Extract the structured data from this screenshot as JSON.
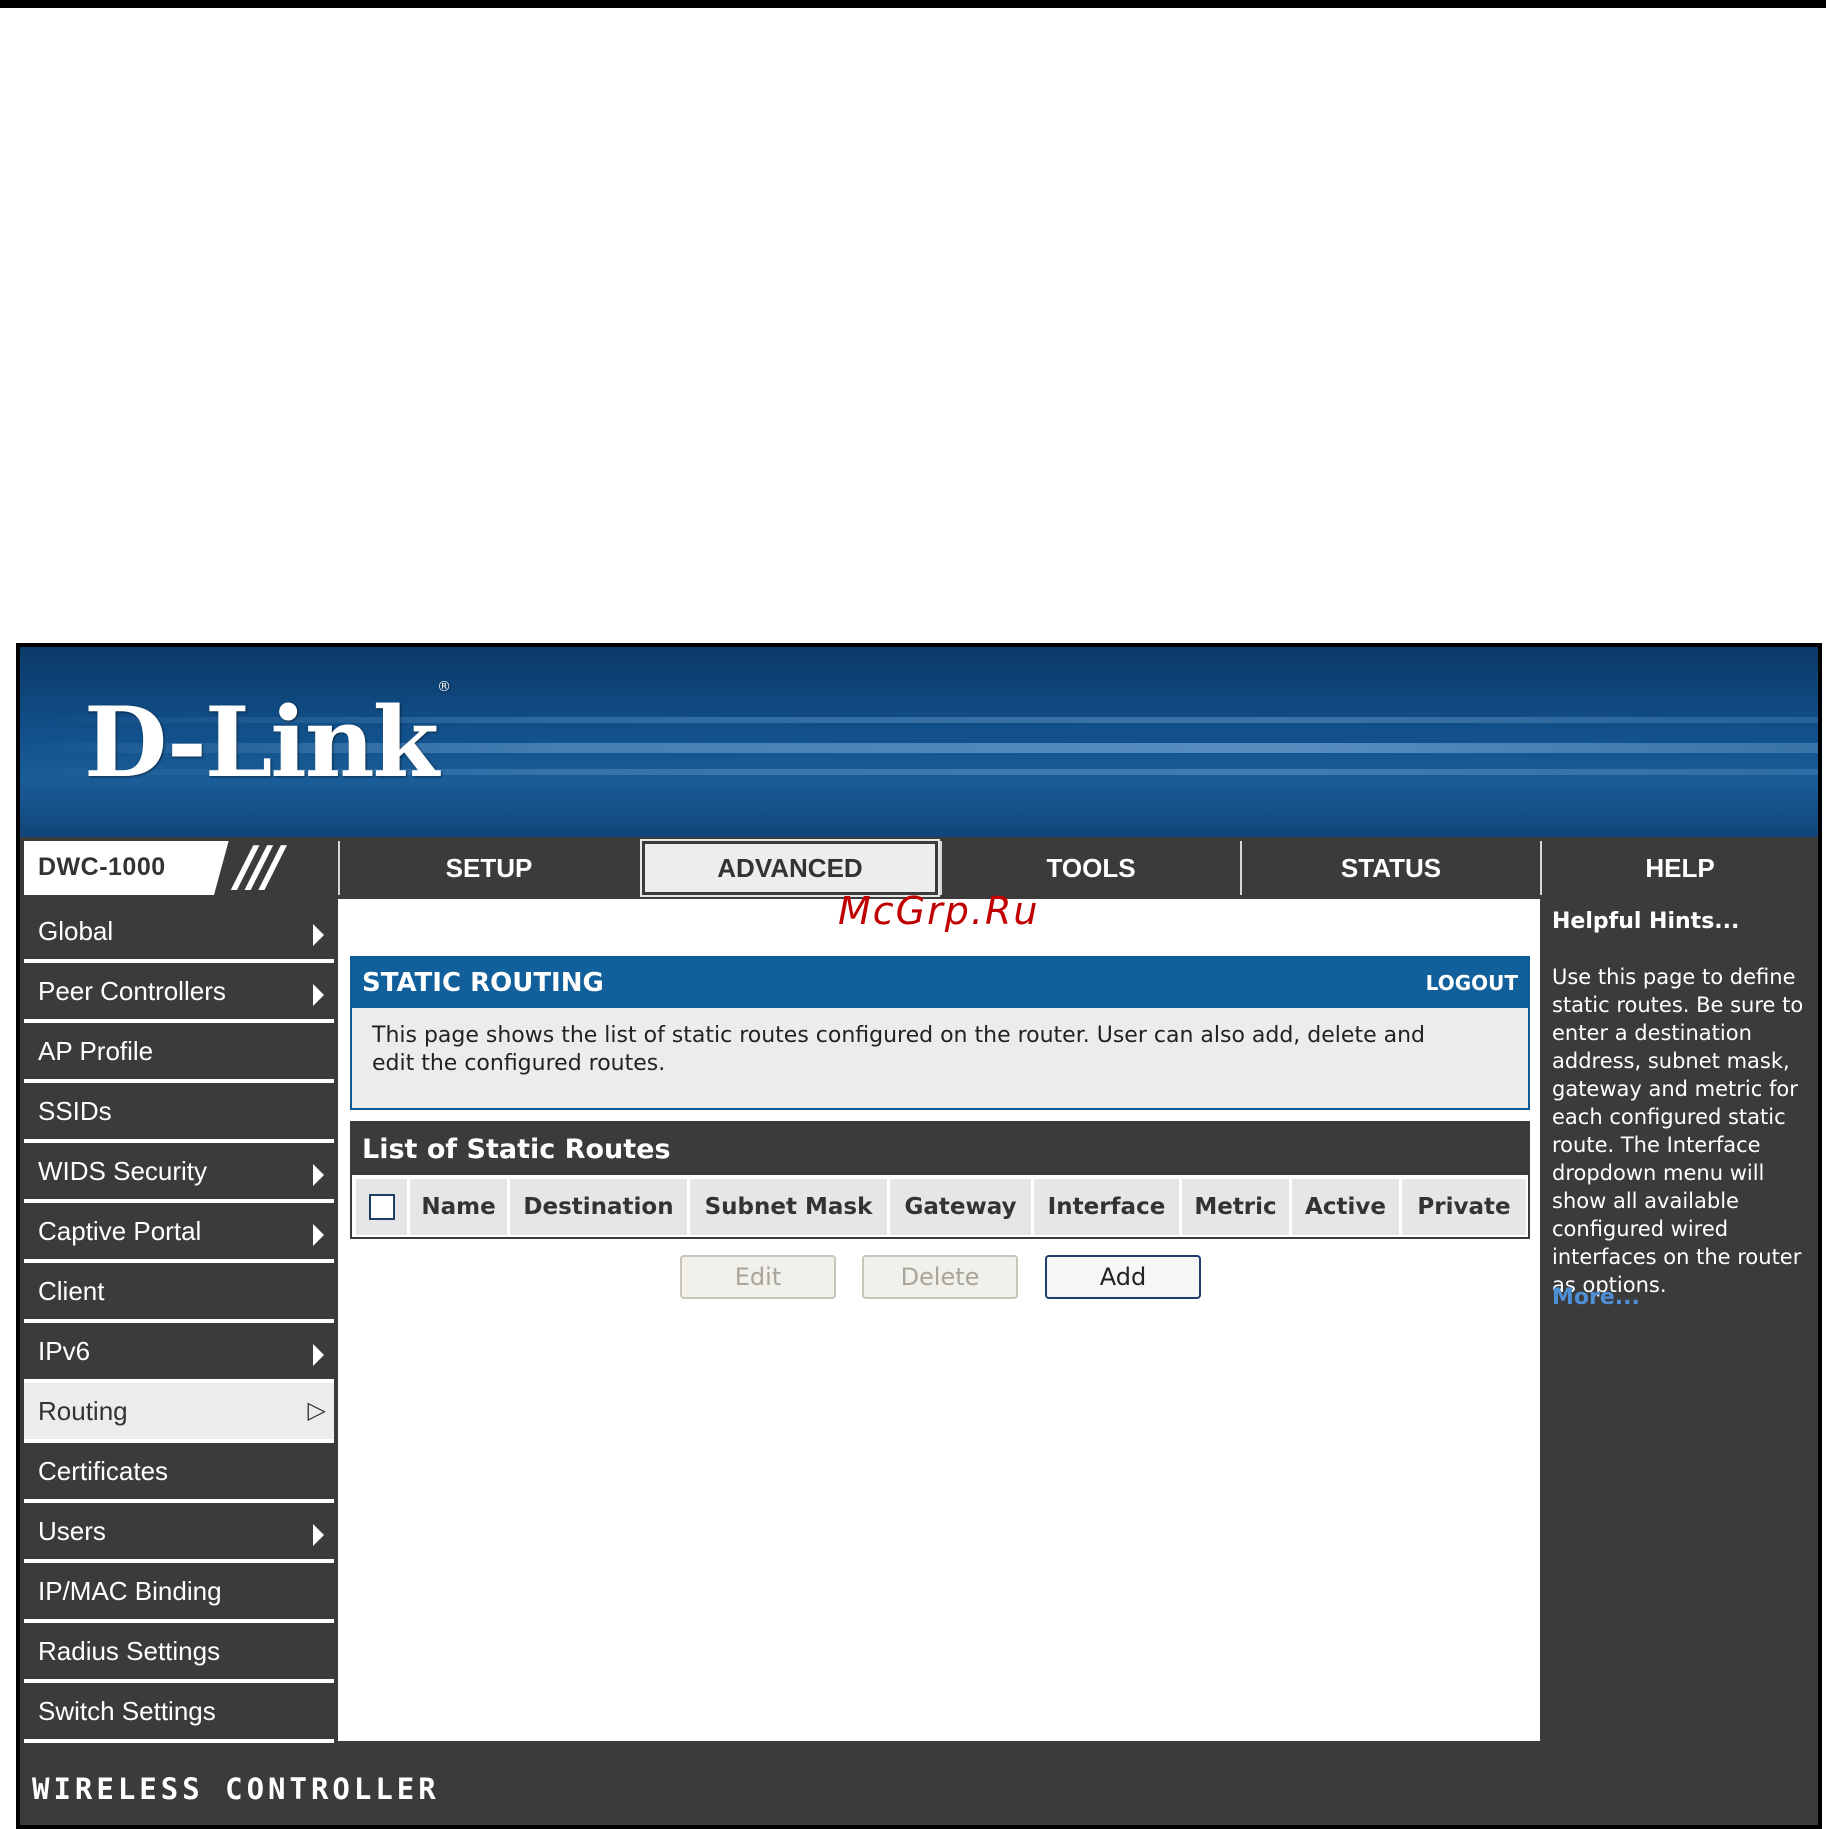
{
  "brand": {
    "logo": "D-Link",
    "registered": "®"
  },
  "model": "DWC-1000",
  "model_separator": "///",
  "nav": {
    "tabs": [
      {
        "label": "SETUP",
        "active": false
      },
      {
        "label": "ADVANCED",
        "active": true
      },
      {
        "label": "TOOLS",
        "active": false
      },
      {
        "label": "STATUS",
        "active": false
      },
      {
        "label": "HELP",
        "active": false
      }
    ]
  },
  "sidebar": {
    "items": [
      {
        "label": "Global",
        "has_submenu": true
      },
      {
        "label": "Peer Controllers",
        "has_submenu": true
      },
      {
        "label": "AP Profile",
        "has_submenu": false
      },
      {
        "label": "SSIDs",
        "has_submenu": false
      },
      {
        "label": "WIDS Security",
        "has_submenu": true
      },
      {
        "label": "Captive Portal",
        "has_submenu": true
      },
      {
        "label": "Client",
        "has_submenu": false
      },
      {
        "label": "IPv6",
        "has_submenu": true
      },
      {
        "label": "Routing",
        "has_submenu": true,
        "active": true
      },
      {
        "label": "Certificates",
        "has_submenu": false
      },
      {
        "label": "Users",
        "has_submenu": true
      },
      {
        "label": "IP/MAC Binding",
        "has_submenu": false
      },
      {
        "label": "Radius Settings",
        "has_submenu": false
      },
      {
        "label": "Switch Settings",
        "has_submenu": false
      }
    ]
  },
  "watermark": "McGrp.Ru",
  "static_routing": {
    "title": "STATIC ROUTING",
    "logout": "LOGOUT",
    "description": "This page shows the list of static routes configured on the router. User can also add, delete and edit the configured routes."
  },
  "routes_table": {
    "title": "List of Static Routes",
    "columns": [
      "Name",
      "Destination",
      "Subnet Mask",
      "Gateway",
      "Interface",
      "Metric",
      "Active",
      "Private"
    ],
    "rows": []
  },
  "buttons": {
    "edit": "Edit",
    "delete": "Delete",
    "add": "Add"
  },
  "help": {
    "title": "Helpful Hints...",
    "text": "Use this page to define static routes. Be sure to enter a destination address, subnet mask, gateway and metric for each configured static route. The Interface dropdown menu will show all available configured wired interfaces on the router as options.",
    "more": "More..."
  },
  "footer": "WIRELESS CONTROLLER",
  "colors": {
    "banner_blue": "#11508a",
    "header_blue": "#11609c",
    "dark_gray": "#3b3b3b",
    "link_blue": "#4e8fd6",
    "watermark_red": "#c00000"
  }
}
